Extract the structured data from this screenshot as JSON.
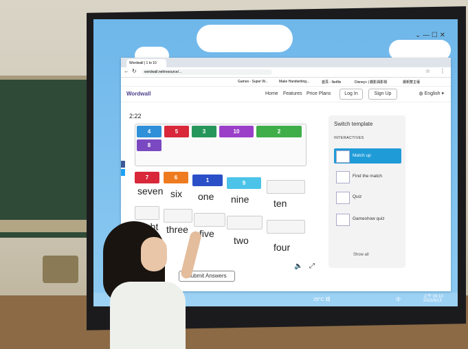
{
  "browser": {
    "tab_title": "Wordwall | 1 to 10",
    "url": "wordwall.net/resource/...",
    "bookmarks": [
      "Games - Super W...",
      "Make Handwriting...",
      "首頁 - Netflix",
      "Disney+ | 觀影與影視",
      "揚帆雙主壇"
    ]
  },
  "wordwall": {
    "logo": "Wordwall",
    "nav": [
      "Home",
      "Features",
      "Price Plans"
    ],
    "login": "Log In",
    "signup": "Sign Up",
    "language": "English"
  },
  "activity": {
    "timer": "2:22",
    "tray_tiles": [
      {
        "label": "4",
        "color": "#2f8fd8"
      },
      {
        "label": "5",
        "color": "#d8283a"
      },
      {
        "label": "3",
        "color": "#27965a"
      },
      {
        "label": "10",
        "color": "#9b3fc9"
      },
      {
        "label": "2",
        "color": "#3fae49"
      },
      {
        "label": "8",
        "color": "#7a49c1"
      }
    ],
    "placed_tiles": [
      {
        "label": "7",
        "color": "#d8283a"
      },
      {
        "label": "6",
        "color": "#ee7b1f"
      },
      {
        "label": "1",
        "color": "#2a4fc7"
      },
      {
        "label": "9",
        "color": "#4cc3e8"
      }
    ],
    "words_row1": [
      "seven",
      "six",
      "one",
      "nine",
      "ten"
    ],
    "words_row2": [
      "eight",
      "three",
      "five",
      "two",
      "four"
    ],
    "submit_label": "Submit Answers"
  },
  "panel": {
    "title": "Switch template",
    "subtitle": "INTERACTIVES",
    "templates": [
      "Match up",
      "Find the match",
      "Quiz",
      "Gameshow quiz"
    ],
    "show_all": "Show all"
  },
  "taskbar": {
    "weather": "29°C 晴",
    "ime": "中",
    "time": "上午 09:10",
    "date": "2023/9/13"
  }
}
